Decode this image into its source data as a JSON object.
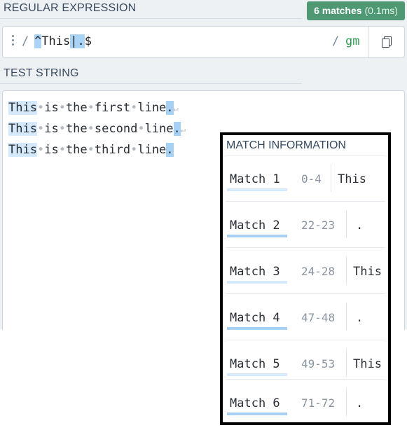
{
  "regex_section": {
    "label": "REGULAR EXPRESSION",
    "match_count": "6 matches",
    "timing": "(0.1ms)",
    "open_slash": "/",
    "pattern_caret": "^",
    "pattern_word": "This",
    "pattern_pipe": "|",
    "pattern_dot": ".",
    "pattern_end": "$",
    "close_slash": "/",
    "flags": "gm"
  },
  "test_section": {
    "label": "TEST STRING",
    "lines": [
      {
        "w1": "This",
        "w2": "is",
        "w3": "the",
        "w4": "first",
        "w5": "line",
        "dot": ".",
        "ws": "•",
        "ret": "↵"
      },
      {
        "w1": "This",
        "w2": "is",
        "w3": "the",
        "w4": "second",
        "w5": "line",
        "dot": ".",
        "ws": "•",
        "ret": "↵"
      },
      {
        "w1": "This",
        "w2": "is",
        "w3": "the",
        "w4": "third",
        "w5": "line",
        "dot": ".",
        "ws": "•",
        "ret": ""
      }
    ]
  },
  "match_info": {
    "title": "MATCH INFORMATION",
    "rows": [
      {
        "label": "Match 1",
        "range": "0-4",
        "value": "This"
      },
      {
        "label": "Match 2",
        "range": "22-23",
        "value": "."
      },
      {
        "label": "Match 3",
        "range": "24-28",
        "value": "This"
      },
      {
        "label": "Match 4",
        "range": "47-48",
        "value": "."
      },
      {
        "label": "Match 5",
        "range": "49-53",
        "value": "This"
      },
      {
        "label": "Match 6",
        "range": "71-72",
        "value": "."
      }
    ]
  },
  "colors": {
    "badge": "#4f9874",
    "match_light": "#d4e9fb",
    "match_dark": "#a6d1f5",
    "flags": "#2e9a55"
  }
}
